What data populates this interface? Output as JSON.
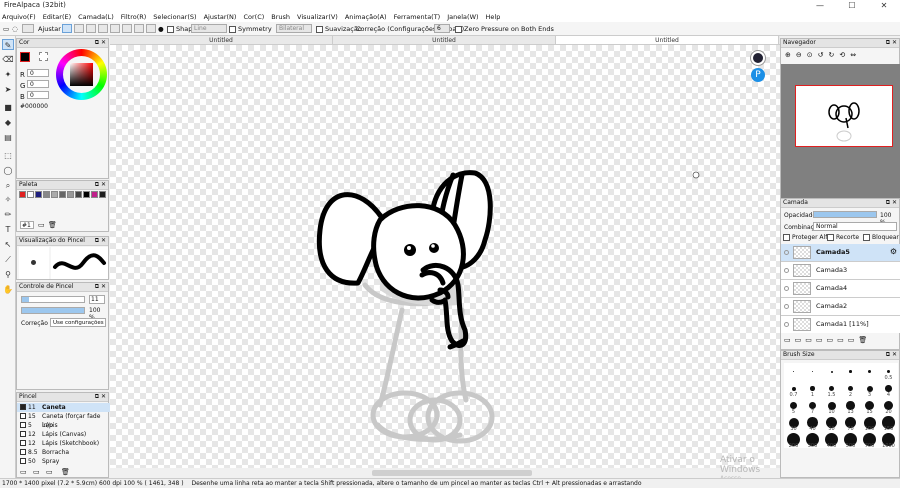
{
  "window": {
    "title": "FireAlpaca (32bit)",
    "controls": [
      "—",
      "☐",
      "✕"
    ]
  },
  "menu": [
    "Arquivo(F)",
    "Editar(E)",
    "Camada(L)",
    "Filtro(R)",
    "Selecionar(S)",
    "Ajustar(N)",
    "Cor(C)",
    "Brush",
    "Visualizar(V)",
    "Animação(A)",
    "Ferramenta(T)",
    "Janela(W)",
    "Help"
  ],
  "toolbar": {
    "ajustar": "Ajustar",
    "shape": "Shape",
    "shape_value": "Line",
    "symmetry": "Symmetry",
    "symmetry_value": "Bilateral",
    "suavizacao": "Suavização",
    "correcao": "Correção (Configurações globais)",
    "correcao_value": "6",
    "zero_pressure": "Zero Pressure on Both Ends"
  },
  "tabs": [
    "Untitled",
    "Untitled",
    "Untitled"
  ],
  "color_panel": {
    "title": "Cor",
    "r_label": "R",
    "r": "0",
    "g_label": "G",
    "g": "0",
    "b_label": "B",
    "b": "0",
    "hex": "#000000"
  },
  "palette_panel": {
    "title": "Paleta",
    "colors": [
      "#e02020",
      "#ffffff",
      "#202080",
      "#888888",
      "#aaaaaa",
      "#666666",
      "#999999",
      "#444444",
      "#000000",
      "#c0208a",
      "#202020"
    ],
    "page": "#1"
  },
  "brush_preview_panel": {
    "title": "Visualização do Pincel"
  },
  "brush_control_panel": {
    "title": "Controle de Pincel",
    "size_value": "11",
    "opacity_value": "100",
    "opacity_unit": "%",
    "size_fill": 0.12,
    "opacity_fill": 1.0,
    "correcao_label": "Correção",
    "correcao_value": "Use configurações"
  },
  "brush_panel": {
    "title": "Pincel",
    "items": [
      {
        "size": "11",
        "name": "Caneta",
        "color": "#222222"
      },
      {
        "size": "15",
        "name": "Caneta (forçar fade in/o",
        "color": "#ffffff"
      },
      {
        "size": "5",
        "name": "Lápis",
        "color": "#ffffff"
      },
      {
        "size": "12",
        "name": "Lápis (Canvas)",
        "color": "#ffffff"
      },
      {
        "size": "12",
        "name": "Lápis (Sketchbook)",
        "color": "#ffffff"
      },
      {
        "size": "8.5",
        "name": "Borracha",
        "color": "#ffffff"
      },
      {
        "size": "50",
        "name": "Spray",
        "color": "#ffffff"
      }
    ]
  },
  "navigator_panel": {
    "title": "Navegador"
  },
  "layer_panel": {
    "title": "Camada",
    "opacity_label": "Opacidade",
    "opacity_value": "100",
    "opacity_unit": "%",
    "blend_label": "Combinação",
    "blend_value": "Normal",
    "protect_alpha": "Proteger Alfa",
    "clipping": "Recorte",
    "lock": "Bloquear",
    "layers": [
      "Camada5",
      "Camada3",
      "Camada4",
      "Camada2",
      "Camada1 [11%]"
    ]
  },
  "brush_size_panel": {
    "title": "Brush Size",
    "sizes": [
      "",
      "",
      "",
      "",
      "",
      "0.5",
      "0.7",
      "1",
      "1.5",
      "2",
      "3",
      "4",
      "5",
      "7",
      "10",
      "13",
      "15",
      "20",
      "30",
      "40",
      "50",
      "70",
      "100",
      "150",
      "200",
      "300",
      "400",
      "500",
      "700",
      "1000"
    ]
  },
  "status": {
    "size": "1700 * 1400 pixel  (7.2 * 5.9cm)  600 dpi  100 %  ( 1461, 348 )",
    "hint": "Desenhe uma linha reta ao manter a tecla Shift pressionada, altere o tamanho de um pincel ao manter as teclas Ctrl + Alt pressionadas e arrastando"
  },
  "watermark": {
    "line1": "Ativar o Windows",
    "line2": "Acesse Configurações"
  },
  "colors": {
    "accent": "#6aa1d8",
    "selected": "#cfe3f7",
    "nav_frame": "#e02020"
  }
}
